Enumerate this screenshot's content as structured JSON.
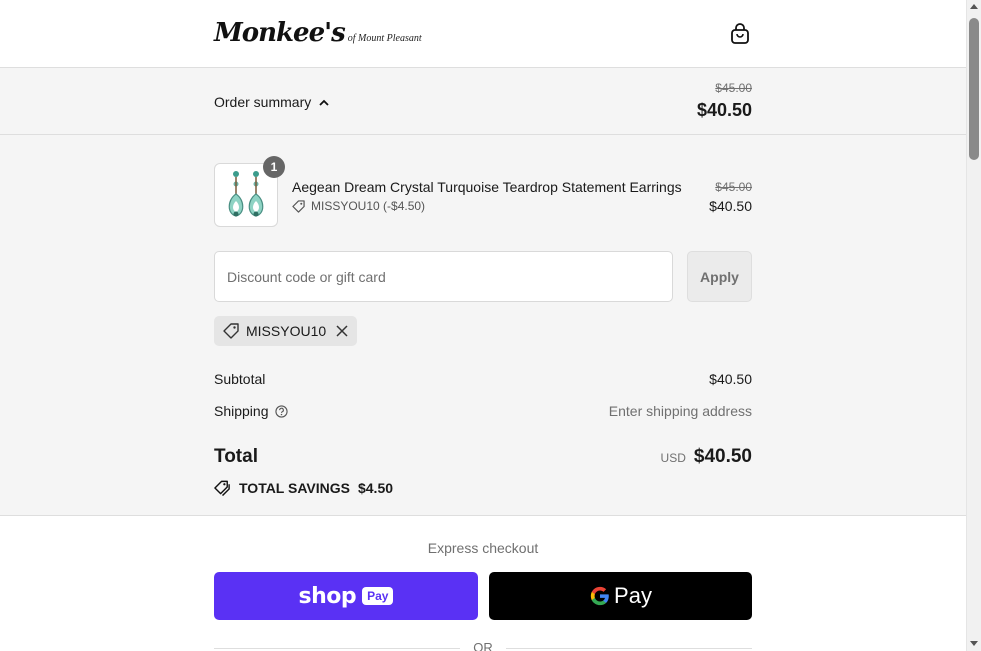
{
  "header": {
    "logo_main": "Monkee's",
    "logo_sub": "of Mount Pleasant",
    "cart_icon": "shopping-bag-icon"
  },
  "summary_bar": {
    "toggle_label": "Order summary",
    "toggle_icon": "chevron-up-icon",
    "original_total": "$45.00",
    "total": "$40.50"
  },
  "line_item": {
    "quantity": "1",
    "title": "Aegean Dream Crystal Turquoise Teardrop Statement Earrings",
    "discount": "MISSYOU10 (-$4.50)",
    "original_price": "$45.00",
    "price": "$40.50"
  },
  "discount": {
    "placeholder": "Discount code or gift card",
    "apply_label": "Apply",
    "applied_code": "MISSYOU10"
  },
  "totals": {
    "subtotal_label": "Subtotal",
    "subtotal_value": "$40.50",
    "shipping_label": "Shipping",
    "shipping_value": "Enter shipping address",
    "total_label": "Total",
    "currency": "USD",
    "total_value": "$40.50",
    "savings_label": "TOTAL SAVINGS",
    "savings_value": "$4.50"
  },
  "express": {
    "label": "Express checkout",
    "shop_word": "shop",
    "shop_pill": "Pay",
    "gpay_word": "Pay",
    "or_label": "OR"
  },
  "colors": {
    "shop_pay": "#5a31f4",
    "gpay": "#000000",
    "panel_bg": "#f5f5f5"
  }
}
